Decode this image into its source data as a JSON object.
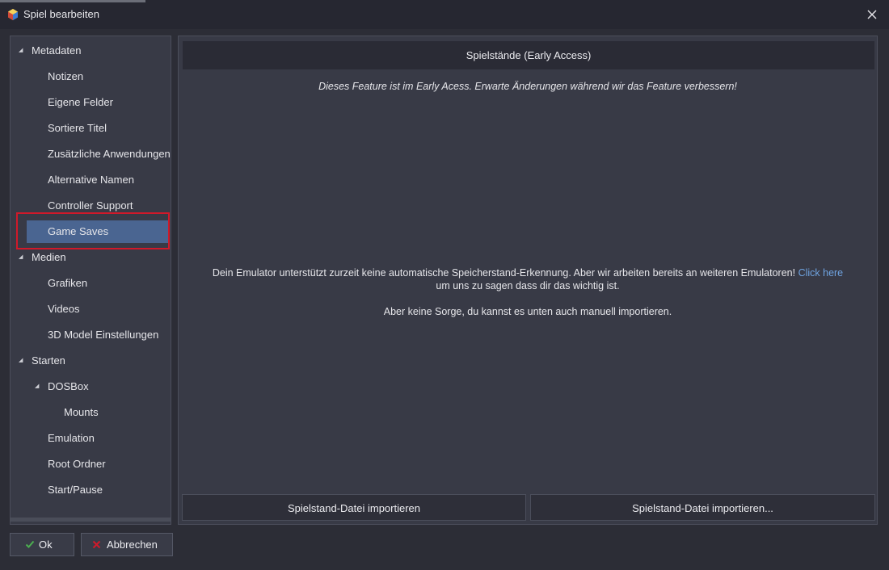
{
  "window": {
    "title": "Spiel bearbeiten"
  },
  "sidebar": {
    "items": [
      {
        "label": "Metadaten",
        "expandable": true
      },
      {
        "label": "Notizen"
      },
      {
        "label": "Eigene Felder"
      },
      {
        "label": "Sortiere Titel"
      },
      {
        "label": "Zusätzliche Anwendungen"
      },
      {
        "label": "Alternative Namen"
      },
      {
        "label": "Controller Support"
      },
      {
        "label": "Game Saves",
        "selected": true
      },
      {
        "label": "Medien",
        "expandable": true
      },
      {
        "label": "Grafiken"
      },
      {
        "label": "Videos"
      },
      {
        "label": "3D Model Einstellungen"
      },
      {
        "label": "Starten",
        "expandable": true
      },
      {
        "label": "DOSBox",
        "expandable": true
      },
      {
        "label": "Mounts"
      },
      {
        "label": "Emulation"
      },
      {
        "label": "Root Ordner"
      },
      {
        "label": "Start/Pause"
      }
    ]
  },
  "main": {
    "header": "Spielstände (Early Access)",
    "early_access_note": "Dieses Feature ist im Early Acess. Erwarte Änderungen während wir das Feature verbessern!",
    "info_line1": "Dein Emulator unterstützt zurzeit keine automatische Speicherstand-Erkennung. Aber wir arbeiten bereits an weiteren Emulatoren!",
    "info_link": "Click here",
    "info_line2": "um uns zu sagen dass dir das wichtig ist.",
    "info_line3": "Aber keine Sorge, du kannst es unten auch manuell importieren.",
    "import_button_1": "Spielstand-Datei importieren",
    "import_button_2": "Spielstand-Datei importieren..."
  },
  "footer": {
    "ok_label": "Ok",
    "cancel_label": "Abbrechen"
  },
  "colors": {
    "selection": "#4a6591",
    "highlight_outline": "#d0192a",
    "link": "#6fa3e0",
    "ok_check": "#4caf50",
    "cancel_x": "#d0192a"
  },
  "icons": [
    "app-icon",
    "close-icon",
    "expand-arrow-icon",
    "check-icon",
    "cancel-icon"
  ]
}
